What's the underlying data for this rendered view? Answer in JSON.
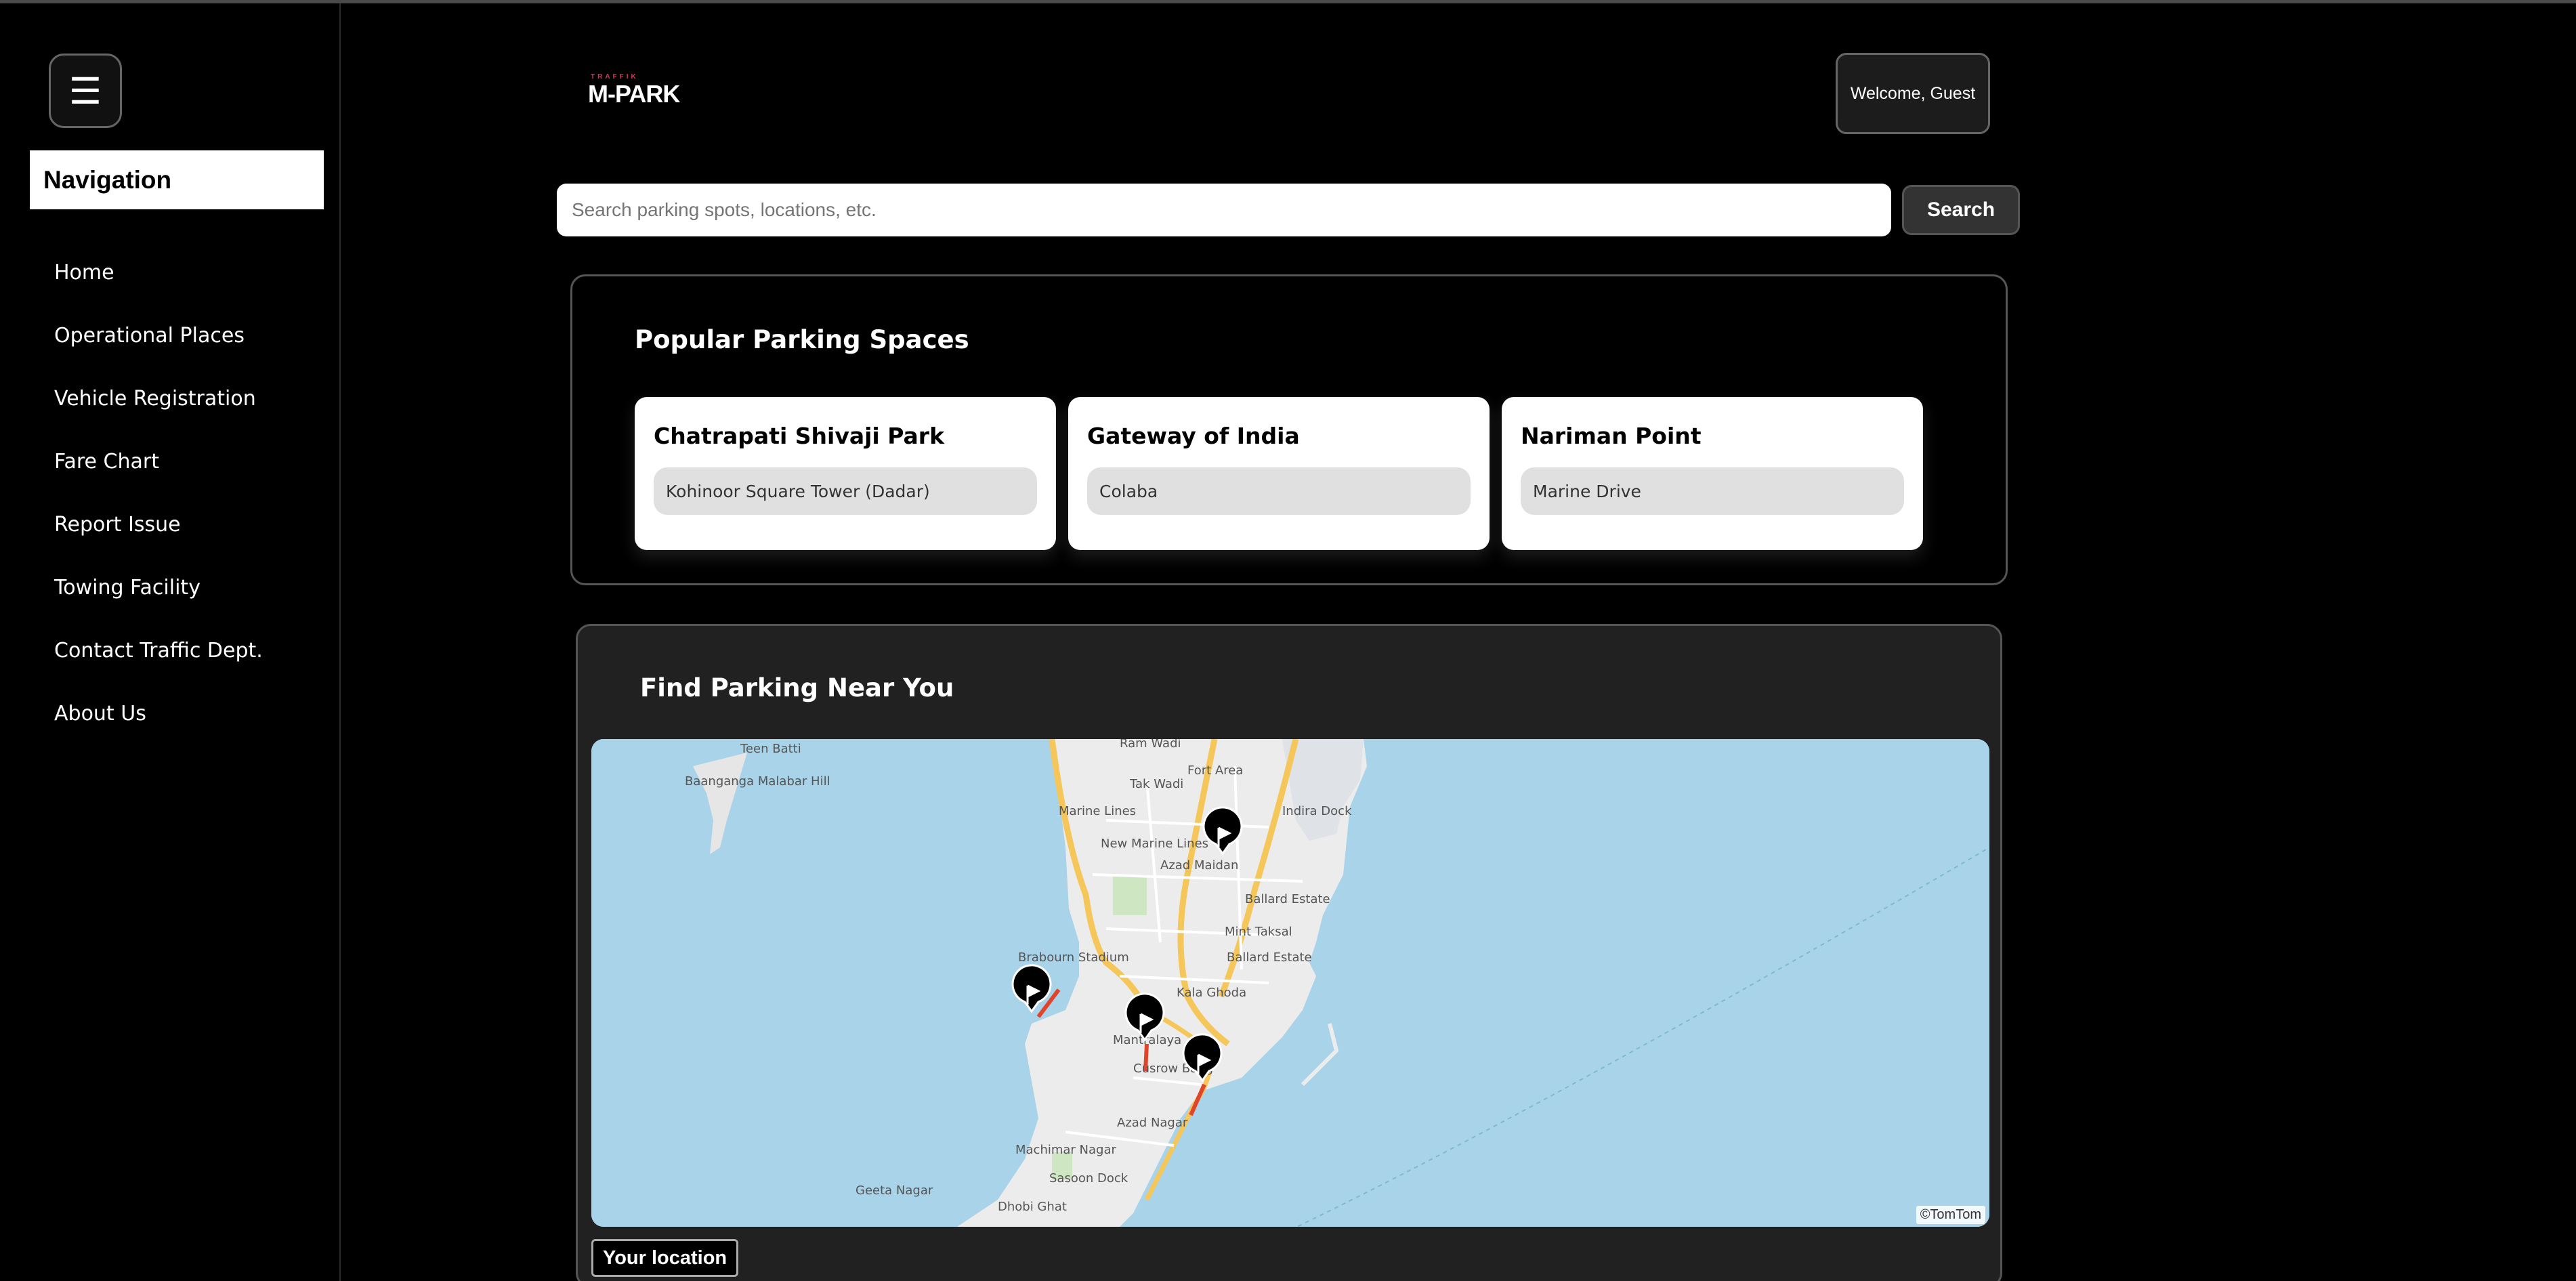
{
  "sidebar": {
    "menu_icon": "☰",
    "title": "Navigation",
    "items": [
      {
        "label": "Home"
      },
      {
        "label": "Operational Places"
      },
      {
        "label": "Vehicle Registration"
      },
      {
        "label": "Fare Chart"
      },
      {
        "label": "Report Issue"
      },
      {
        "label": "Towing Facility"
      },
      {
        "label": "Contact Traffic Dept."
      },
      {
        "label": "About Us"
      }
    ]
  },
  "header": {
    "logo_small": "TRAFFIK",
    "logo_big": "M-PARK",
    "welcome": "Welcome, Guest"
  },
  "search": {
    "placeholder": "Search parking spots, locations, etc.",
    "button": "Search"
  },
  "popular": {
    "title": "Popular Parking Spaces",
    "cards": [
      {
        "title": "Chatrapati Shivaji Park",
        "subtitle": "Kohinoor Square Tower (Dadar)"
      },
      {
        "title": "Gateway of India",
        "subtitle": "Colaba"
      },
      {
        "title": "Nariman Point",
        "subtitle": "Marine Drive"
      }
    ]
  },
  "find": {
    "title": "Find Parking Near You",
    "map_labels": [
      "Teen Batti",
      "Baanganga Malabar Hill",
      "Ram Wadi",
      "Fort Area",
      "Tak Wadi",
      "Marine Lines",
      "Indira Dock",
      "New Marine Lines",
      "Azad Maidan",
      "Ballard Estate",
      "Mint Taksal",
      "Brabourn Stadium",
      "Ballard Estate",
      "Kala Ghoda",
      "Mantralaya",
      "Cusrow Baug",
      "Azad Nagar",
      "Machimar Nagar",
      "Sasoon Dock",
      "Geeta Nagar",
      "Dhobi Ghat"
    ],
    "attribution": "©TomTom",
    "your_location": "Your location"
  },
  "colors": {
    "background": "#000000",
    "panel": "#212121",
    "water": "#a9d3e8",
    "land": "#ececec",
    "road_major": "#f5c75a",
    "traffic_red": "#e0452b"
  }
}
